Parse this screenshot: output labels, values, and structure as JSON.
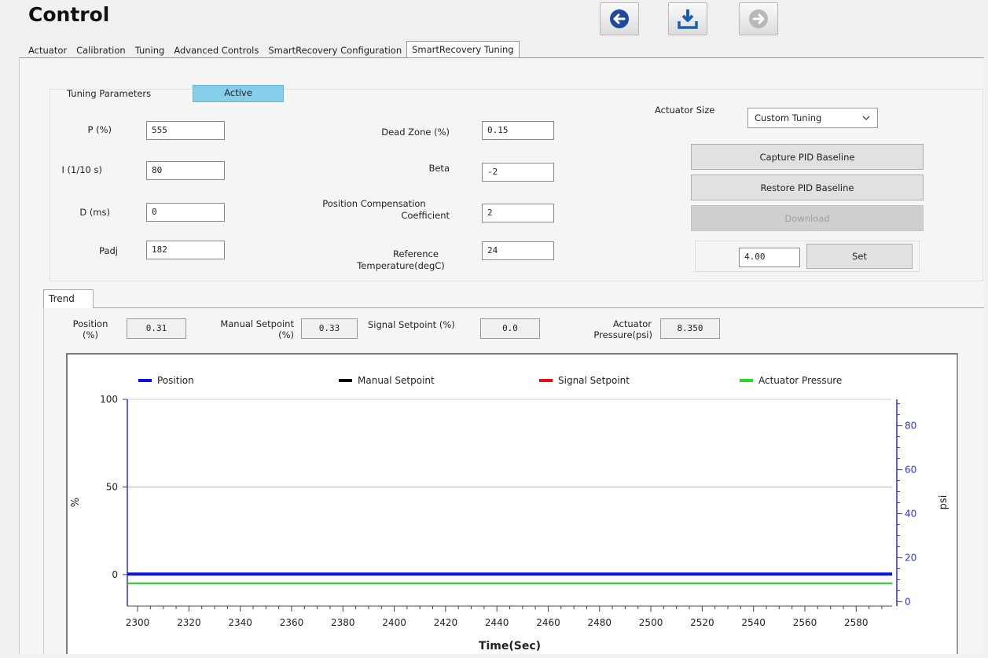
{
  "header": {
    "title": "Control"
  },
  "toolbar": [
    {
      "name": "back",
      "icon": "arrow-left-circle-icon",
      "color": "#1e4a9e",
      "enabled": true
    },
    {
      "name": "download",
      "icon": "download-icon",
      "color": "#1a5fb4",
      "enabled": true
    },
    {
      "name": "forward",
      "icon": "arrow-right-circle-icon",
      "color": "#b8b8b8",
      "enabled": false
    }
  ],
  "tabs": [
    {
      "label": "Actuator",
      "active": false
    },
    {
      "label": "Calibration",
      "active": false
    },
    {
      "label": "Tuning",
      "active": false
    },
    {
      "label": "Advanced Controls",
      "active": false
    },
    {
      "label": "SmartRecovery Configuration",
      "active": false
    },
    {
      "label": "SmartRecovery Tuning",
      "active": true
    }
  ],
  "tuning": {
    "group_label": "Tuning Parameters",
    "status": "Active",
    "status_color": "#87ceeb",
    "p_label": "P (%)",
    "p_value": "555",
    "i_label": "I (1/10 s)",
    "i_value": "80",
    "d_label": "D (ms)",
    "d_value": "0",
    "padj_label": "Padj",
    "padj_value": "182",
    "deadzone_label": "Dead Zone (%)",
    "deadzone_value": "0.15",
    "beta_label": "Beta",
    "beta_value": "-2",
    "poscomp_label_1": "Position Compensation",
    "poscomp_label_2": "Coefficient",
    "poscomp_value": "2",
    "reftemp_label_1": "Reference",
    "reftemp_label_2": "Temperature(degC)",
    "reftemp_value": "24",
    "actuator_size_label": "Actuator Size",
    "actuator_size_value": "Custom Tuning",
    "capture_label": "Capture PID Baseline",
    "restore_label": "Restore PID Baseline",
    "download_label": "Download",
    "set_value": "4.00",
    "set_label": "Set"
  },
  "trend": {
    "tab_label": "Trend",
    "position_label_1": "Position",
    "position_label_2": "(%)",
    "position_value": "0.31",
    "manual_label_1": "Manual Setpoint",
    "manual_label_2": "(%)",
    "manual_value": "0.33",
    "signal_label": "Signal Setpoint (%)",
    "signal_value": "0.0",
    "pressure_label_1": "Actuator",
    "pressure_label_2": "Pressure(psi)",
    "pressure_value": "8.350"
  },
  "chart_data": {
    "type": "line",
    "xlabel": "Time(Sec)",
    "ylabel_left": "%",
    "ylabel_right": "psi",
    "xlim": [
      2296,
      2594
    ],
    "ylim_left": [
      -18,
      100
    ],
    "ylim_right": [
      -2,
      92
    ],
    "x_ticks": [
      2300,
      2320,
      2340,
      2360,
      2380,
      2400,
      2420,
      2440,
      2460,
      2480,
      2500,
      2520,
      2540,
      2560,
      2580
    ],
    "y_ticks_left": [
      0,
      50,
      100
    ],
    "y_ticks_right": [
      0,
      20,
      40,
      60,
      80
    ],
    "gridline_left": 50,
    "legend_position": "top",
    "series": [
      {
        "name": "Position",
        "color": "#1010e0",
        "axis": "left",
        "x": [
          2296,
          2594
        ],
        "y": [
          0.31,
          0.31
        ]
      },
      {
        "name": "Manual Setpoint",
        "color": "#000000",
        "axis": "left",
        "x": [
          2296,
          2594
        ],
        "y": [
          0.33,
          0.33
        ]
      },
      {
        "name": "Signal Setpoint",
        "color": "#e01010",
        "axis": "left",
        "x": [
          2296,
          2594
        ],
        "y": [
          0.0,
          0.0
        ]
      },
      {
        "name": "Actuator Pressure",
        "color": "#22dd22",
        "axis": "right",
        "x": [
          2296,
          2594
        ],
        "y": [
          8.35,
          8.35
        ]
      }
    ]
  }
}
